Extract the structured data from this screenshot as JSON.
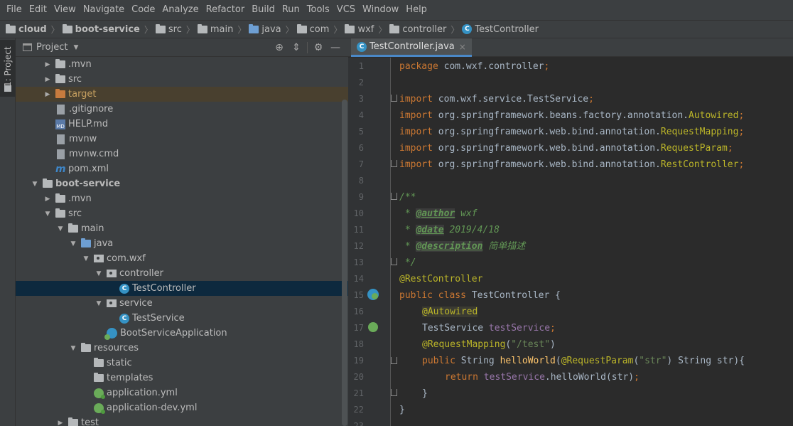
{
  "menu": [
    "File",
    "Edit",
    "View",
    "Navigate",
    "Code",
    "Analyze",
    "Refactor",
    "Build",
    "Run",
    "Tools",
    "VCS",
    "Window",
    "Help"
  ],
  "breadcrumb": [
    "cloud",
    "boot-service",
    "src",
    "main",
    "java",
    "com",
    "wxf",
    "controller",
    "TestController"
  ],
  "toolstrip": {
    "label": "1: Project"
  },
  "project_panel": {
    "title": "Project"
  },
  "tree": [
    {
      "label": ".mvn",
      "depth": 1,
      "arrow": "right",
      "icon": "folder"
    },
    {
      "label": "src",
      "depth": 1,
      "arrow": "right",
      "icon": "folder"
    },
    {
      "label": "target",
      "depth": 1,
      "arrow": "right",
      "icon": "folder-orange",
      "state": "excluded"
    },
    {
      "label": ".gitignore",
      "depth": 1,
      "icon": "file"
    },
    {
      "label": "HELP.md",
      "depth": 1,
      "icon": "md"
    },
    {
      "label": "mvnw",
      "depth": 1,
      "icon": "file"
    },
    {
      "label": "mvnw.cmd",
      "depth": 1,
      "icon": "file"
    },
    {
      "label": "pom.xml",
      "depth": 1,
      "icon": "maven"
    },
    {
      "label": "boot-service",
      "depth": 0,
      "arrow": "down",
      "icon": "module",
      "bold": true
    },
    {
      "label": ".mvn",
      "depth": 1,
      "arrow": "right",
      "icon": "folder"
    },
    {
      "label": "src",
      "depth": 1,
      "arrow": "down",
      "icon": "folder"
    },
    {
      "label": "main",
      "depth": 2,
      "arrow": "down",
      "icon": "folder"
    },
    {
      "label": "java",
      "depth": 3,
      "arrow": "down",
      "icon": "folder-blue"
    },
    {
      "label": "com.wxf",
      "depth": 4,
      "arrow": "down",
      "icon": "package"
    },
    {
      "label": "controller",
      "depth": 5,
      "arrow": "down",
      "icon": "package"
    },
    {
      "label": "TestController",
      "depth": 6,
      "icon": "class",
      "state": "selected"
    },
    {
      "label": "service",
      "depth": 5,
      "arrow": "down",
      "icon": "package"
    },
    {
      "label": "TestService",
      "depth": 6,
      "icon": "class"
    },
    {
      "label": "BootServiceApplication",
      "depth": 5,
      "icon": "boot"
    },
    {
      "label": "resources",
      "depth": 3,
      "arrow": "down",
      "icon": "folder-res"
    },
    {
      "label": "static",
      "depth": 4,
      "icon": "folder"
    },
    {
      "label": "templates",
      "depth": 4,
      "icon": "folder"
    },
    {
      "label": "application.yml",
      "depth": 4,
      "icon": "yml"
    },
    {
      "label": "application-dev.yml",
      "depth": 4,
      "icon": "yml"
    },
    {
      "label": "test",
      "depth": 2,
      "arrow": "right",
      "icon": "folder"
    }
  ],
  "editor": {
    "tab": "TestController.java",
    "line_numbers": [
      "1",
      "2",
      "3",
      "4",
      "5",
      "6",
      "7",
      "8",
      "9",
      "10",
      "11",
      "12",
      "13",
      "14",
      "15",
      "16",
      "17",
      "18",
      "19",
      "20",
      "21",
      "22",
      "23"
    ]
  },
  "code": {
    "l1": [
      "package",
      " com.wxf.controller",
      ";"
    ],
    "l3": [
      "import",
      " com.wxf.service.TestService",
      ";"
    ],
    "l4": [
      "import",
      " org.springframework.beans.factory.annotation.",
      "Autowired",
      ";"
    ],
    "l5": [
      "import",
      " org.springframework.web.bind.annotation.",
      "RequestMapping",
      ";"
    ],
    "l6": [
      "import",
      " org.springframework.web.bind.annotation.",
      "RequestParam",
      ";"
    ],
    "l7": [
      "import",
      " org.springframework.web.bind.annotation.",
      "RestController",
      ";"
    ],
    "l9": "/**",
    "l10": [
      " * ",
      "@author",
      " wxf"
    ],
    "l11": [
      " * ",
      "@date",
      " 2019/4/18"
    ],
    "l12": [
      " * ",
      "@description",
      " 简单描述"
    ],
    "l13": " */",
    "l14": "@RestController",
    "l15": [
      "public class",
      " TestController {"
    ],
    "l16": "@Autowired",
    "l17": [
      "TestService ",
      "testService",
      ";"
    ],
    "l18": [
      "@RequestMapping",
      "(",
      "\"/test\"",
      ")"
    ],
    "l19": [
      "public",
      " String ",
      "helloWorld",
      "(",
      "@RequestParam",
      "(",
      "\"str\"",
      ") String str){"
    ],
    "l20": [
      "return ",
      "testService",
      ".helloWorld(str)",
      ";"
    ],
    "l21": "}",
    "l22": "}"
  }
}
